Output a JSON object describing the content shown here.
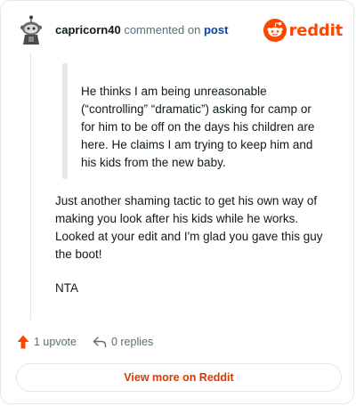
{
  "header": {
    "username": "capricorn40",
    "action_text": "commented on",
    "post_link": "post",
    "logo_text": "reddit"
  },
  "comment": {
    "quote": "He thinks I am being unreasonable (“controlling” “dramatic”) asking for camp or for him to be off on the days his children are here. He claims I am trying to keep him and his kids from the new baby.",
    "body": "Just another shaming tactic to get his own way of making you look after his kids while he works. Looked at your edit and I'm glad you gave this guy the boot!",
    "verdict": "NTA"
  },
  "actions": {
    "upvotes": "1 upvote",
    "replies": "0 replies"
  },
  "footer": {
    "view_more": "View more on Reddit"
  },
  "colors": {
    "brand": "#ff4500",
    "link": "#0a449b",
    "cta": "#d93a00",
    "muted": "#576f76",
    "border": "#e5e8ea"
  },
  "icons": [
    "snoo-avatar-icon",
    "reddit-logo-icon",
    "upvote-arrow-icon",
    "reply-arrow-icon"
  ]
}
